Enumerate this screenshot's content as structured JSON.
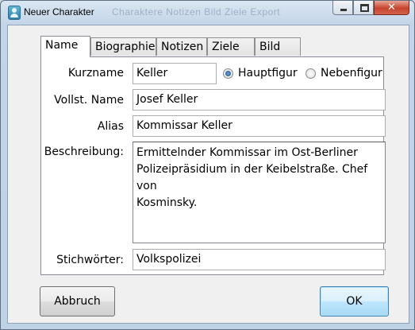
{
  "window": {
    "title": "Neuer Charakter",
    "background_title": "Charaktere  Notizen  Bild  Ziele  Export"
  },
  "tabs": [
    {
      "label": "Name",
      "active": true
    },
    {
      "label": "Biographie",
      "active": false
    },
    {
      "label": "Notizen",
      "active": false
    },
    {
      "label": "Ziele",
      "active": false
    },
    {
      "label": "Bild",
      "active": false
    }
  ],
  "form": {
    "kurzname_label": "Kurzname",
    "kurzname_value": "Keller",
    "role_options": [
      {
        "label": "Hauptfigur",
        "selected": true
      },
      {
        "label": "Nebenfigur",
        "selected": false
      }
    ],
    "vollname_label": "Vollst. Name",
    "vollname_value": "Josef Keller",
    "alias_label": "Alias",
    "alias_value": "Kommissar Keller",
    "beschreibung_label": "Beschreibung:",
    "beschreibung_lines": [
      "Ermittelnder Kommissar im Ost-Berliner",
      "Polizeipräsidium in der Keibelstraße. Chef von",
      "Kosminsky."
    ],
    "stichwoerter_label": "Stichwörter:",
    "stichwoerter_value": "Volkspolizei"
  },
  "buttons": {
    "cancel": "Abbruch",
    "ok": "OK"
  },
  "colors": {
    "frame": "#c3d5e8",
    "close_button": "#c7432c",
    "default_button_border": "#3c7fb1"
  }
}
